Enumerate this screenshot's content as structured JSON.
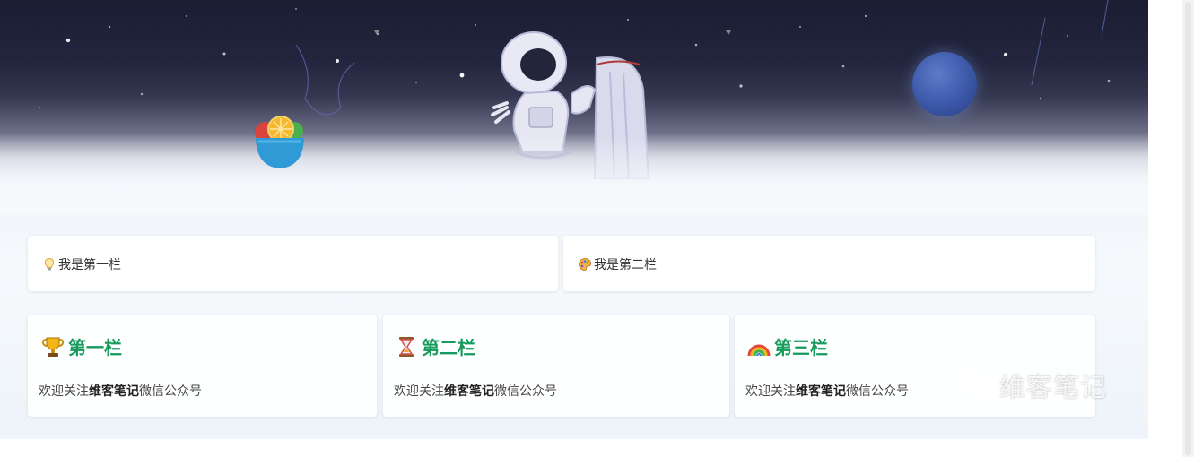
{
  "row1": {
    "left_label": "我是第一栏",
    "left_icon": "lightbulb-icon",
    "right_label": "我是第二栏",
    "right_icon": "palette-icon"
  },
  "columns": [
    {
      "title": "第一栏",
      "icon": "trophy-icon",
      "desc_prefix": "欢迎关注",
      "desc_bold": "维客笔记",
      "desc_suffix": "微信公众号"
    },
    {
      "title": "第二栏",
      "icon": "hourglass-icon",
      "desc_prefix": "欢迎关注",
      "desc_bold": "维客笔记",
      "desc_suffix": "微信公众号"
    },
    {
      "title": "第三栏",
      "icon": "rainbow-icon",
      "desc_prefix": "欢迎关注",
      "desc_bold": "维客笔记",
      "desc_suffix": "微信公众号"
    }
  ],
  "watermark": {
    "text": "维客笔记",
    "icon": "wechat-icon"
  },
  "colors": {
    "title_green": "#169b5d",
    "space_dark": "#1b1d33",
    "planet_blue": "#3b57a8"
  }
}
